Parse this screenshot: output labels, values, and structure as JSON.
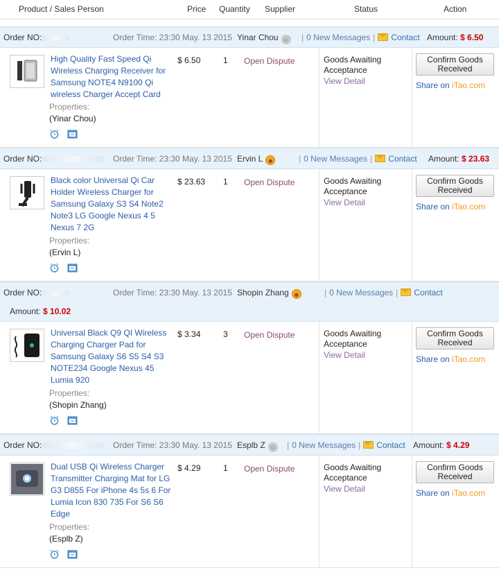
{
  "header": {
    "product": "Product / Sales Person",
    "price": "Price",
    "quantity": "Quantity",
    "supplier": "Supplier",
    "status": "Status",
    "action": "Action"
  },
  "labels": {
    "order_no": "Order NO:",
    "order_time_prefix": "Order Time:",
    "new_messages": "0 New Messages",
    "contact": "Contact",
    "amount": "Amount:",
    "properties": "Properties:",
    "open_dispute": "Open Dispute",
    "status_line": "Goods Awaiting Acceptance",
    "view_detail": "View Detail",
    "confirm": "Confirm Goods Received",
    "share_prefix": "Share on ",
    "share_brand": "iTao.com"
  },
  "orders": [
    {
      "order_time": "Order Time: 23:30 May. 13 2015",
      "seller": "Yinar Chou",
      "seller_face": "grey",
      "amount": "$ 6.50",
      "item": {
        "title": "High Quality Fast Speed Qi Wireless Charging Receiver for Samsung NOTE4 N9100 Qi wireless Charger Accept Card",
        "buyer": "(Yinar Chou)",
        "price": "$ 6.50",
        "qty": "1"
      }
    },
    {
      "order_time": "Order Time: 23:30 May. 13 2015",
      "seller": "Ervin L",
      "seller_face": "orange",
      "amount": "$ 23.63",
      "item": {
        "title": "Black color Universal Qi Car Holder Wireless Charger for Samsung Galaxy S3 S4 Note2 Note3 LG Google Nexus 4 5 Nexus 7 2G",
        "buyer": "(Ervin L)",
        "price": "$ 23.63",
        "qty": "1"
      }
    },
    {
      "order_time": "Order Time: 23:30 May. 13 2015",
      "seller": "Shopin Zhang",
      "seller_face": "orange",
      "amount": "$ 10.02",
      "item": {
        "title": "Universal Black Q9 QI Wireless Charging Charger Pad for Samsung Galaxy S6 S5 S4 S3 NOTE234 Google Nexus 45 Lumia 920",
        "buyer": "(Shopin Zhang)",
        "price": "$ 3.34",
        "qty": "3"
      }
    },
    {
      "order_time": "Order Time: 23:30 May. 13 2015",
      "seller": "Esplb Z",
      "seller_face": "grey",
      "amount": "$ 4.29",
      "item": {
        "title": "Dual USB Qi Wireless Charger Transmitter Charging Mat for LG G3 D855 For iPhone 4s 5s 6 For Lumia Icon 830 735 For S6 S6 Edge",
        "buyer": "(Esplb Z)",
        "price": "$ 4.29",
        "qty": "1"
      }
    }
  ]
}
